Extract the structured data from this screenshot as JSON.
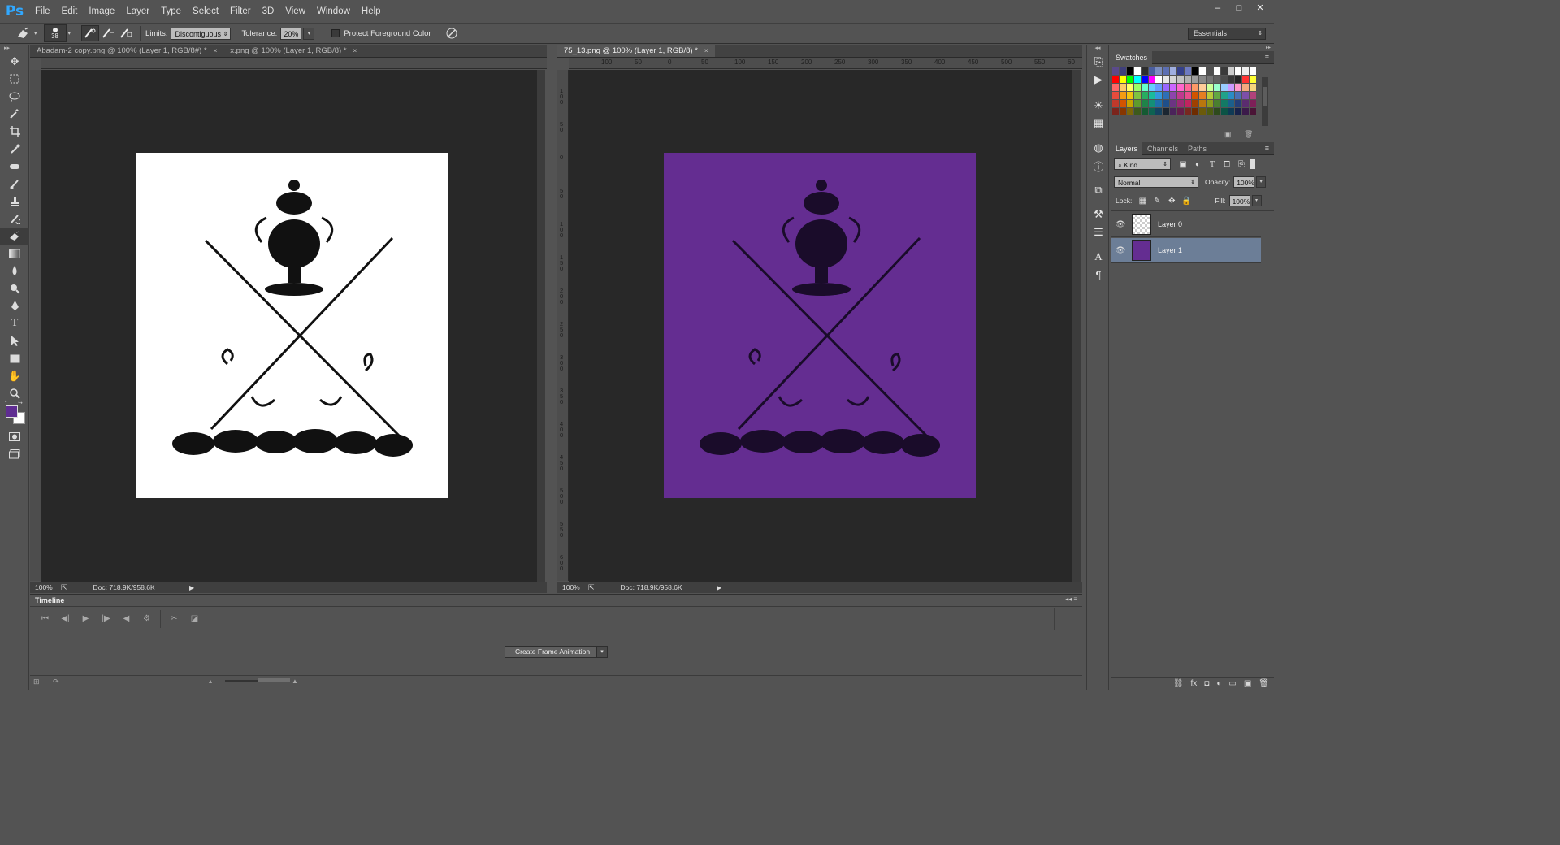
{
  "app": {
    "logo": "Ps",
    "menu": [
      "File",
      "Edit",
      "Image",
      "Layer",
      "Type",
      "Select",
      "Filter",
      "3D",
      "View",
      "Window",
      "Help"
    ],
    "window_controls": [
      "–",
      "□",
      "✕"
    ]
  },
  "options_bar": {
    "brush_size": "38",
    "limits_label": "Limits:",
    "limits_value": "Discontiguous",
    "tolerance_label": "Tolerance:",
    "tolerance_value": "20%",
    "protect_label": "Protect Foreground Color",
    "workspace": "Essentials"
  },
  "toolbox": {
    "foreground_color": "#5f2d91",
    "background_color": "#ffffff"
  },
  "documents": {
    "left": {
      "tabs": [
        {
          "label": "Abadam-2 copy.png @ 100% (Layer 1, RGB/8#) *",
          "close": "×",
          "active": false
        },
        {
          "label": "x.png @ 100% (Layer 1, RGB/8) *",
          "close": "×",
          "active": false
        }
      ],
      "zoom": "100%",
      "doc_size": "Doc: 718.9K/958.6K",
      "canvas_color": "#ffffff"
    },
    "right": {
      "tabs": [
        {
          "label": "75_13.png @ 100% (Layer 1, RGB/8) *",
          "close": "×",
          "active": true
        }
      ],
      "zoom": "100%",
      "doc_size": "Doc: 718.9K/958.6K",
      "canvas_color": "#642d91",
      "ruler_labels": [
        "100",
        "50",
        "0",
        "50",
        "100",
        "150",
        "200",
        "250",
        "300",
        "350",
        "400",
        "450",
        "500",
        "550",
        "60"
      ],
      "vruler_labels": [
        "100",
        "50",
        "0",
        "50",
        "100",
        "150",
        "200",
        "250",
        "300",
        "350",
        "400",
        "450",
        "500",
        "550",
        "600"
      ]
    }
  },
  "swatches": {
    "title": "Swatches",
    "rows": [
      [
        "#5a4a8a",
        "#3f3f7a",
        "#000000",
        "#ffffff",
        "#2d2d2d",
        "#4b5ea0",
        "#7a8dc0",
        "#5c6fb3",
        "#9faee0",
        "#35408a",
        "#6e7ac0",
        "#000000",
        "#ffffff",
        "#505050",
        "#ffffff",
        "#3a3a3a",
        "#cccccc",
        "#ffffff",
        "#eeeeee",
        "#ffffff"
      ],
      [
        "#ff0000",
        "#ffff00",
        "#00ff00",
        "#00ffff",
        "#0000ff",
        "#ff00ff",
        "#ffffff",
        "#e6e6e6",
        "#d6d6d6",
        "#c2c2c2",
        "#b0b0b0",
        "#9c9c9c",
        "#888888",
        "#747474",
        "#606060",
        "#4c4c4c",
        "#383838",
        "#242424",
        "#ff3333",
        "#ffff33"
      ],
      [
        "#ff6666",
        "#ffcc66",
        "#ffff66",
        "#99ff66",
        "#66ffcc",
        "#66ccff",
        "#6699ff",
        "#9966ff",
        "#cc66ff",
        "#ff66cc",
        "#ff6699",
        "#ff9966",
        "#ffcc99",
        "#ccff99",
        "#99ffcc",
        "#99ccff",
        "#cc99ff",
        "#ff99cc",
        "#f5a97f",
        "#f7d67d"
      ],
      [
        "#e84b3c",
        "#f39c12",
        "#f1c40f",
        "#7fc241",
        "#27ae60",
        "#1abc9c",
        "#3498db",
        "#2e6fb5",
        "#8e44ad",
        "#c0398f",
        "#e74c8c",
        "#d35400",
        "#e67e22",
        "#b8c93a",
        "#63a843",
        "#20a28a",
        "#2a8cc4",
        "#4a6fb5",
        "#7d4fa8",
        "#b1427a"
      ],
      [
        "#c0392b",
        "#d35400",
        "#c7a400",
        "#5e9b2c",
        "#1e8449",
        "#148f77",
        "#1f6fa8",
        "#1e4f8a",
        "#6c3483",
        "#9c2a74",
        "#c0245f",
        "#a04000",
        "#b9770e",
        "#8a9a1f",
        "#4a7f2f",
        "#137a65",
        "#1b5f8c",
        "#243e78",
        "#5b2c6f",
        "#7e1f58"
      ],
      [
        "#7b241c",
        "#873600",
        "#7d6608",
        "#3d5a1c",
        "#145a32",
        "#0e6251",
        "#154360",
        "#1b2631",
        "#4a235a",
        "#641e4a",
        "#78281f",
        "#6e2c00",
        "#6b5a0a",
        "#4d5c12",
        "#2e4a1d",
        "#0b5345",
        "#0f3a55",
        "#17224a",
        "#3b1a4a",
        "#4a1436"
      ]
    ]
  },
  "layers_panel": {
    "tabs": [
      "Layers",
      "Channels",
      "Paths"
    ],
    "kind_label": "Kind",
    "blend_mode": "Normal",
    "opacity_label": "Opacity:",
    "opacity_value": "100%",
    "lock_label": "Lock:",
    "fill_label": "Fill:",
    "fill_value": "100%",
    "layers": [
      {
        "name": "Layer 0",
        "selected": false,
        "thumb": "transparent"
      },
      {
        "name": "Layer 1",
        "selected": true,
        "thumb": "#642d91"
      }
    ]
  },
  "timeline": {
    "title": "Timeline",
    "create_button": "Create Frame Animation"
  }
}
